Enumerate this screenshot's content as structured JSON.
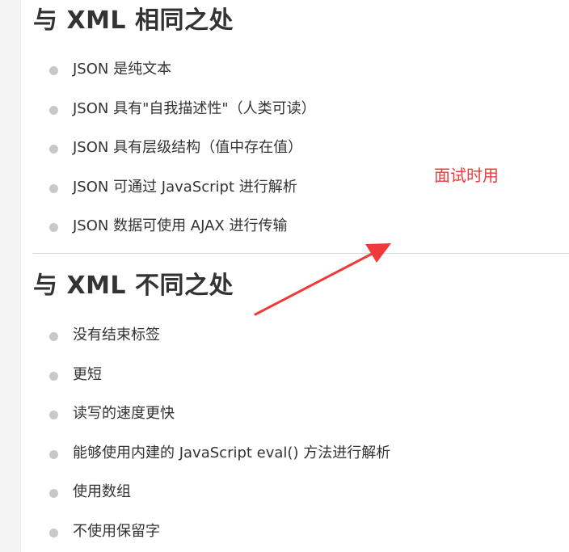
{
  "section1": {
    "heading": "与 XML 相同之处",
    "items": [
      "JSON 是纯文本",
      "JSON 具有\"自我描述性\"（人类可读）",
      "JSON 具有层级结构（值中存在值）",
      "JSON 可通过 JavaScript 进行解析",
      "JSON 数据可使用 AJAX 进行传输"
    ]
  },
  "section2": {
    "heading": "与 XML 不同之处",
    "items": [
      "没有结束标签",
      "更短",
      "读写的速度更快",
      "能够使用内建的 JavaScript eval() 方法进行解析",
      "使用数组",
      "不使用保留字"
    ]
  },
  "annotation": {
    "text": "面试时用",
    "color": "#f03a3a"
  }
}
